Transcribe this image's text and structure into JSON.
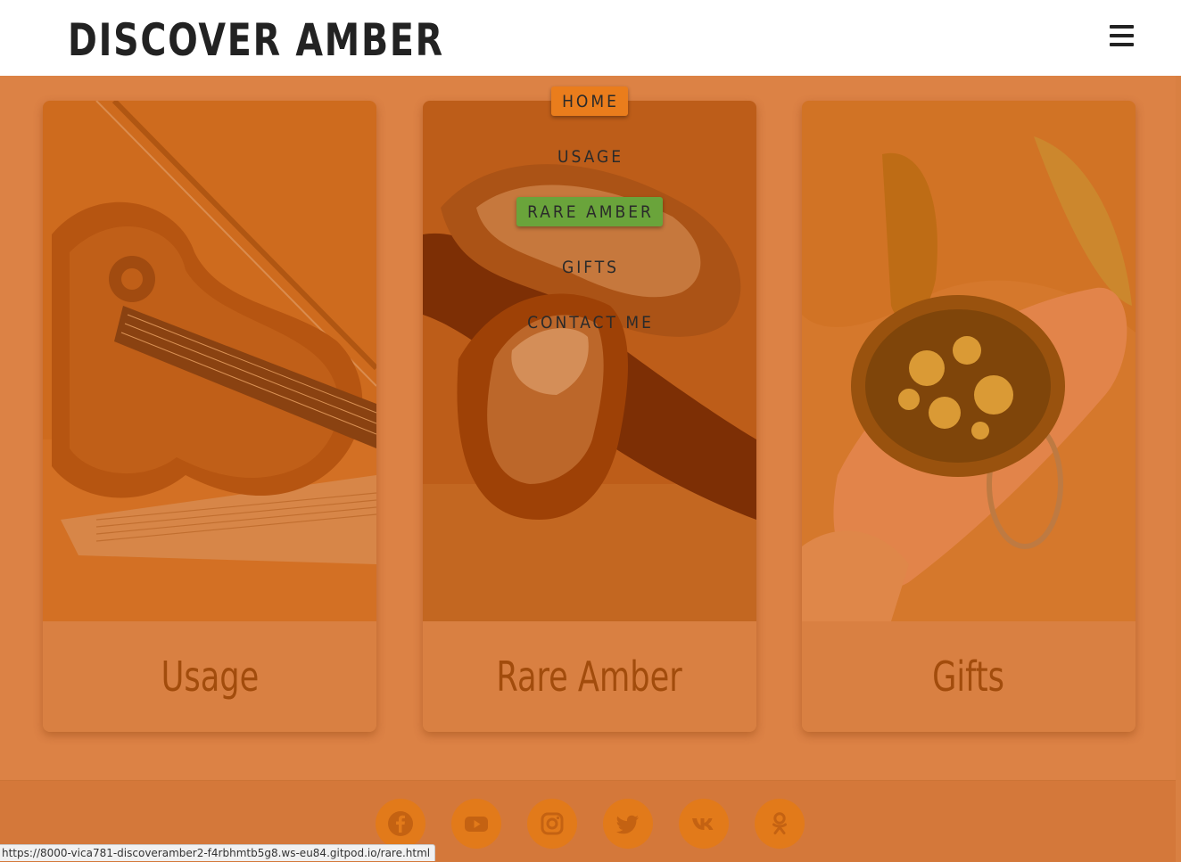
{
  "header": {
    "brand": "DISCOVER AMBER",
    "menu_icon": "hamburger-menu-icon"
  },
  "nav": {
    "items": [
      {
        "label": "HOME",
        "state": "current"
      },
      {
        "label": "USAGE",
        "state": "normal"
      },
      {
        "label": "RARE AMBER",
        "state": "hover"
      },
      {
        "label": "GIFTS",
        "state": "normal"
      },
      {
        "label": "CONTACT ME",
        "state": "normal"
      }
    ]
  },
  "cards": [
    {
      "title": "Usage",
      "image": "violin-photo"
    },
    {
      "title": "Rare Amber",
      "image": "amber-stones-photo"
    },
    {
      "title": "Gifts",
      "image": "amber-ring-photo"
    }
  ],
  "footer": {
    "social": [
      "facebook-icon",
      "youtube-icon",
      "instagram-icon",
      "twitter-icon",
      "vk-icon",
      "odnoklassniki-icon"
    ]
  },
  "status_bar": {
    "url": "https://8000-vica781-discoveramber2-f4rbhmtb5g8.ws-eu84.gitpod.io/rare.html"
  },
  "colors": {
    "page_bg": "#dc8245",
    "brand_text": "#222222",
    "caption_text": "#a24c0c",
    "home_highlight": "#ea7d1c",
    "active_highlight": "#6aa43b",
    "social_bg": "#e27a1a"
  }
}
